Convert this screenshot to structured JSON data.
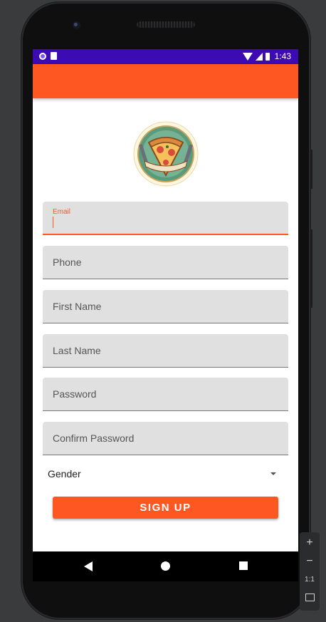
{
  "status_bar": {
    "time": "1:43"
  },
  "form": {
    "email": {
      "label": "Email",
      "value": ""
    },
    "phone": {
      "placeholder": "Phone"
    },
    "first_name": {
      "placeholder": "First Name"
    },
    "last_name": {
      "placeholder": "Last Name"
    },
    "password": {
      "placeholder": "Password"
    },
    "confirm_password": {
      "placeholder": "Confirm Password"
    },
    "gender": {
      "selected": "Gender"
    },
    "signup_label": "SIGN UP"
  },
  "emulator_controls": {
    "zoom_in": "+",
    "zoom_out": "−",
    "one_to_one": "1:1"
  },
  "colors": {
    "accent": "#ff5722",
    "status_bar": "#3d0bb4"
  }
}
